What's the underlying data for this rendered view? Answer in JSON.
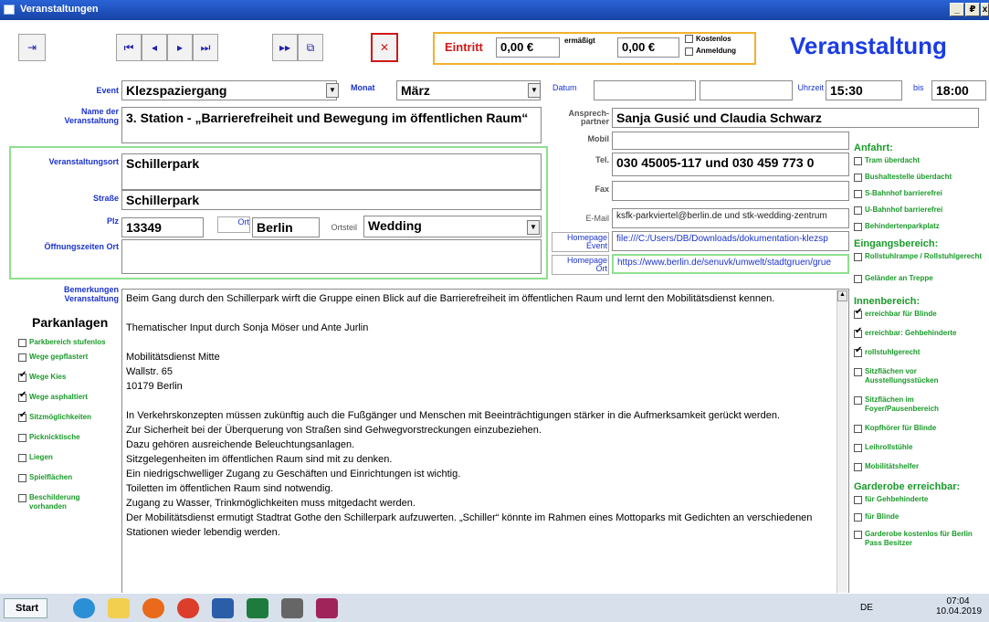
{
  "window": {
    "title": "Veranstaltungen",
    "buttons": [
      "_",
      "₽",
      "x"
    ]
  },
  "toolbar": {
    "nav": [
      "⏮",
      "◂",
      "▸",
      "⏭",
      "▸▸",
      "⧉"
    ],
    "cancel": "✕",
    "eintritt_label": "Eintritt",
    "eintritt_value": "0,00 €",
    "ermaessigt_label": "ermäßigt",
    "ermaessigt_value": "0,00 €",
    "kostenlos_label": "Kostenlos",
    "anmeldung_label": "Anmeldung",
    "page_title": "Veranstaltung"
  },
  "event_row": {
    "event_label": "Event",
    "event_value": "Klezspaziergang",
    "monat_label": "Monat",
    "monat_value": "März",
    "datum_label": "Datum",
    "datum_value": "",
    "bis_label": "bis",
    "bis_value": "",
    "uhrzeit_label": "Uhrzeit",
    "uhrzeit_value": "15:30",
    "bis2_label": "bis",
    "bis2_value": "18:00"
  },
  "veranstaltung": {
    "name_label": "Name der Veranstaltung",
    "name_value": "3. Station - „Barrierefreiheit und Bewegung im öffentlichen Raum“",
    "ort_label": "Veranstaltungsort",
    "ort_value": "Schillerpark",
    "strasse_label": "Straße",
    "strasse_value": "Schillerpark",
    "plz_label": "Plz",
    "plz_value": "13349",
    "ortx_label": "Ort",
    "ortx_value": "Berlin",
    "ortsteil_label": "Ortsteil",
    "ortsteil_value": "Wedding",
    "oeffnung_label": "Öffnungszeiten Ort",
    "oeffnung_value": ""
  },
  "kontakt": {
    "ansprech_label": "Ansprech- partner",
    "ansprech_value": "Sanja Gusić und Claudia Schwarz",
    "mobil_label": "Mobil",
    "mobil_value": "",
    "tel_label": "Tel.",
    "tel_value": "030 45005-117 und 030 459 773 0",
    "fax_label": "Fax",
    "fax_value": "",
    "email_label": "E-Mail",
    "email_value": "ksfk-parkviertel@berlin.de und stk-wedding-zentrum",
    "hp_event_label": "Homepage Event",
    "hp_event_value": "file:///C:/Users/DB/Downloads/dokumentation-klezsp",
    "hp_ort_label": "Homepage Ort",
    "hp_ort_value": "https://www.berlin.de/senuvk/umwelt/stadtgruen/grue"
  },
  "bemerkungen": {
    "label": "Bemerkungen Veranstaltung",
    "paragraphs": [
      "Beim Gang durch den Schillerpark wirft die Gruppe einen Blick auf die Barrierefreiheit im öffentlichen Raum und lernt den Mobilitätsdienst kennen.",
      "",
      "Thematischer Input durch Sonja Möser und Ante Jurlin",
      "",
      "Mobilitätsdienst Mitte",
      "Wallstr. 65",
      "10179 Berlin",
      "",
      "   In Verkehrskonzepten müssen zukünftig auch die Fußgänger und Menschen mit Beeinträchtigungen stärker in die Aufmerksamkeit gerückt werden.",
      "   Zur Sicherheit bei der Überquerung von Straßen sind Gehwegvorstreckungen einzubeziehen.",
      "   Dazu gehören ausreichende Beleuchtungsanlagen.",
      "   Sitzgelegenheiten im öffentlichen Raum sind mit zu denken.",
      "   Ein niedrigschwelliger Zugang zu Geschäften und Einrichtungen ist wichtig.",
      "   Toiletten im öffentlichen Raum sind notwendig.",
      "   Zugang zu Wasser, Trinkmöglichkeiten muss mitgedacht werden.",
      "   Der Mobilitätsdienst ermutigt Stadtrat Gothe den Schillerpark aufzuwerten. „Schiller“ könnte im Rahmen eines Mottoparks mit Gedichten an verschiedenen Stationen wieder lebendig werden."
    ]
  },
  "parkanlagen": {
    "title": "Parkanlagen",
    "items": [
      {
        "label": "Parkbereich stufenlos",
        "checked": false
      },
      {
        "label": "Wege gepflastert",
        "checked": false
      },
      {
        "label": "Wege Kies",
        "checked": true
      },
      {
        "label": "Wege asphaltiert",
        "checked": true
      },
      {
        "label": "Sitzmöglichkeiten",
        "checked": true
      },
      {
        "label": "Picknicktische",
        "checked": false
      },
      {
        "label": "Liegen",
        "checked": false
      },
      {
        "label": "Spielflächen",
        "checked": false
      },
      {
        "label": "Beschilderung vorhanden",
        "checked": false
      }
    ]
  },
  "right_panel": {
    "anfahrt_title": "Anfahrt:",
    "anfahrt": [
      {
        "label": "Tram überdacht",
        "checked": false
      },
      {
        "label": "Bushaltestelle überdacht",
        "checked": false
      },
      {
        "label": "S-Bahnhof barrierefrei",
        "checked": false
      },
      {
        "label": "U-Bahnhof barrierefrei",
        "checked": false
      },
      {
        "label": "Behindertenparkplatz",
        "checked": false
      }
    ],
    "eingang_title": "Eingangsbereich:",
    "eingang": [
      {
        "label": "Rollstuhlrampe / Rollstuhlgerecht",
        "checked": false
      },
      {
        "label": "Geländer an Treppe",
        "checked": false
      }
    ],
    "innen_title": "Innenbereich:",
    "innen": [
      {
        "label": "erreichbar für Blinde",
        "checked": true
      },
      {
        "label": "erreichbar: Gehbehinderte",
        "checked": true
      },
      {
        "label": "rollstuhlgerecht",
        "checked": true
      },
      {
        "label": "Sitzflächen vor Ausstellungsstücken",
        "checked": false
      },
      {
        "label": "Sitzflächen im Foyer/Pausenbereich",
        "checked": false
      },
      {
        "label": "Kopfhörer für Blinde",
        "checked": false
      },
      {
        "label": "Leihrollstühle",
        "checked": false
      },
      {
        "label": "Mobilitätshelfer",
        "checked": false
      }
    ],
    "garderobe_title": "Garderobe erreichbar:",
    "garderobe": [
      {
        "label": "für Gehbehinderte",
        "checked": false
      },
      {
        "label": "für Blinde",
        "checked": false
      },
      {
        "label": "Garderobe kostenlos für Berlin Pass Besitzer",
        "checked": false
      }
    ]
  },
  "taskbar": {
    "start": "Start",
    "lang": "DE",
    "time": "07:04",
    "date": "10.04.2019",
    "apps": [
      "ie-icon",
      "explorer-icon",
      "firefox-icon",
      "chrome-icon",
      "word-icon",
      "excel-icon",
      "app-icon",
      "access-icon"
    ]
  }
}
